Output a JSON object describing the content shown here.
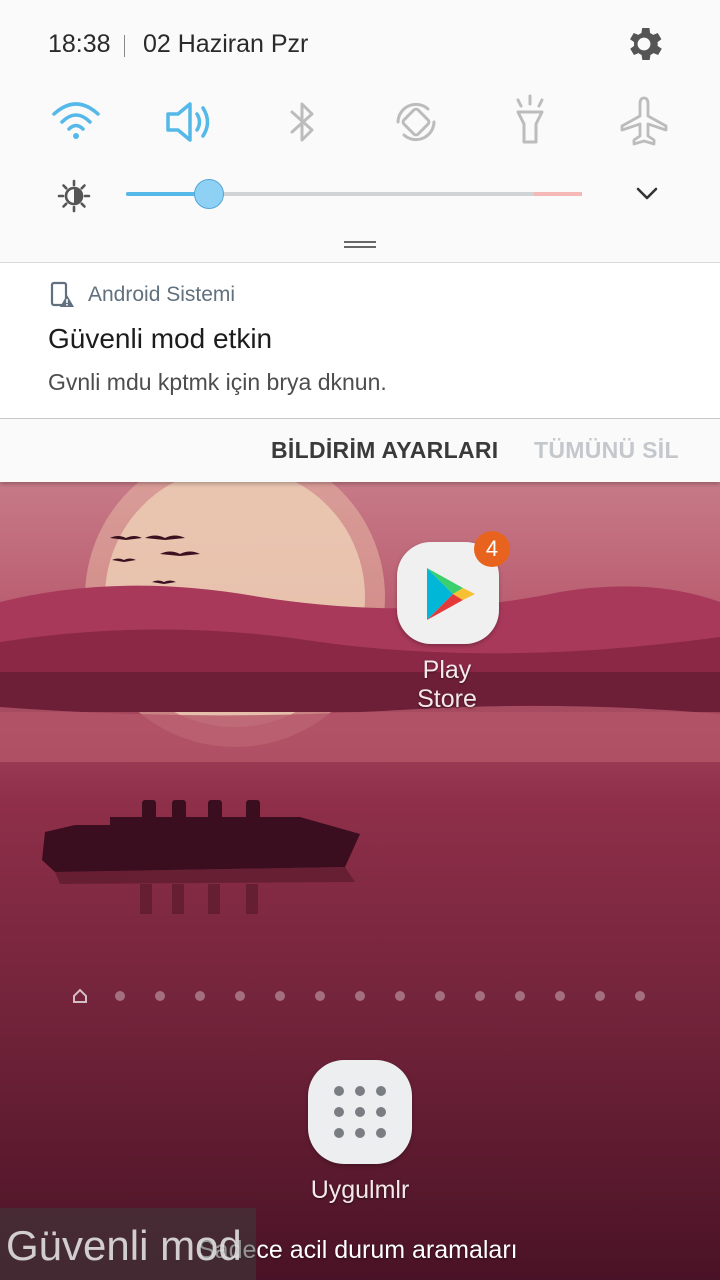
{
  "status": {
    "time": "18:38",
    "date": "02 Haziran Pzr"
  },
  "quick_settings": {
    "icons": [
      "wifi-icon",
      "volume-icon",
      "bluetooth-icon",
      "auto-rotate-icon",
      "flashlight-icon",
      "airplane-mode-icon"
    ],
    "active_color": "#54b8e8",
    "inactive_color": "#bcbcbc"
  },
  "brightness": {
    "level_percent": 18
  },
  "notification": {
    "app_name": "Android Sistemi",
    "title": "Güvenli mod etkin",
    "body": "Gvnli mdu kptmk için brya dknun."
  },
  "actions": {
    "settings_label": "BİLDİRİM AYARLARI",
    "clear_label": "TÜMÜNÜ SİL"
  },
  "home": {
    "play_store_label": "Play Store",
    "play_store_badge": "4",
    "apps_label": "Uygulmlr",
    "emergency_text": "Sadece acil durum aramaları",
    "safe_mode_label": "Güvenli mod",
    "page_count": 14,
    "current_page": 0
  }
}
